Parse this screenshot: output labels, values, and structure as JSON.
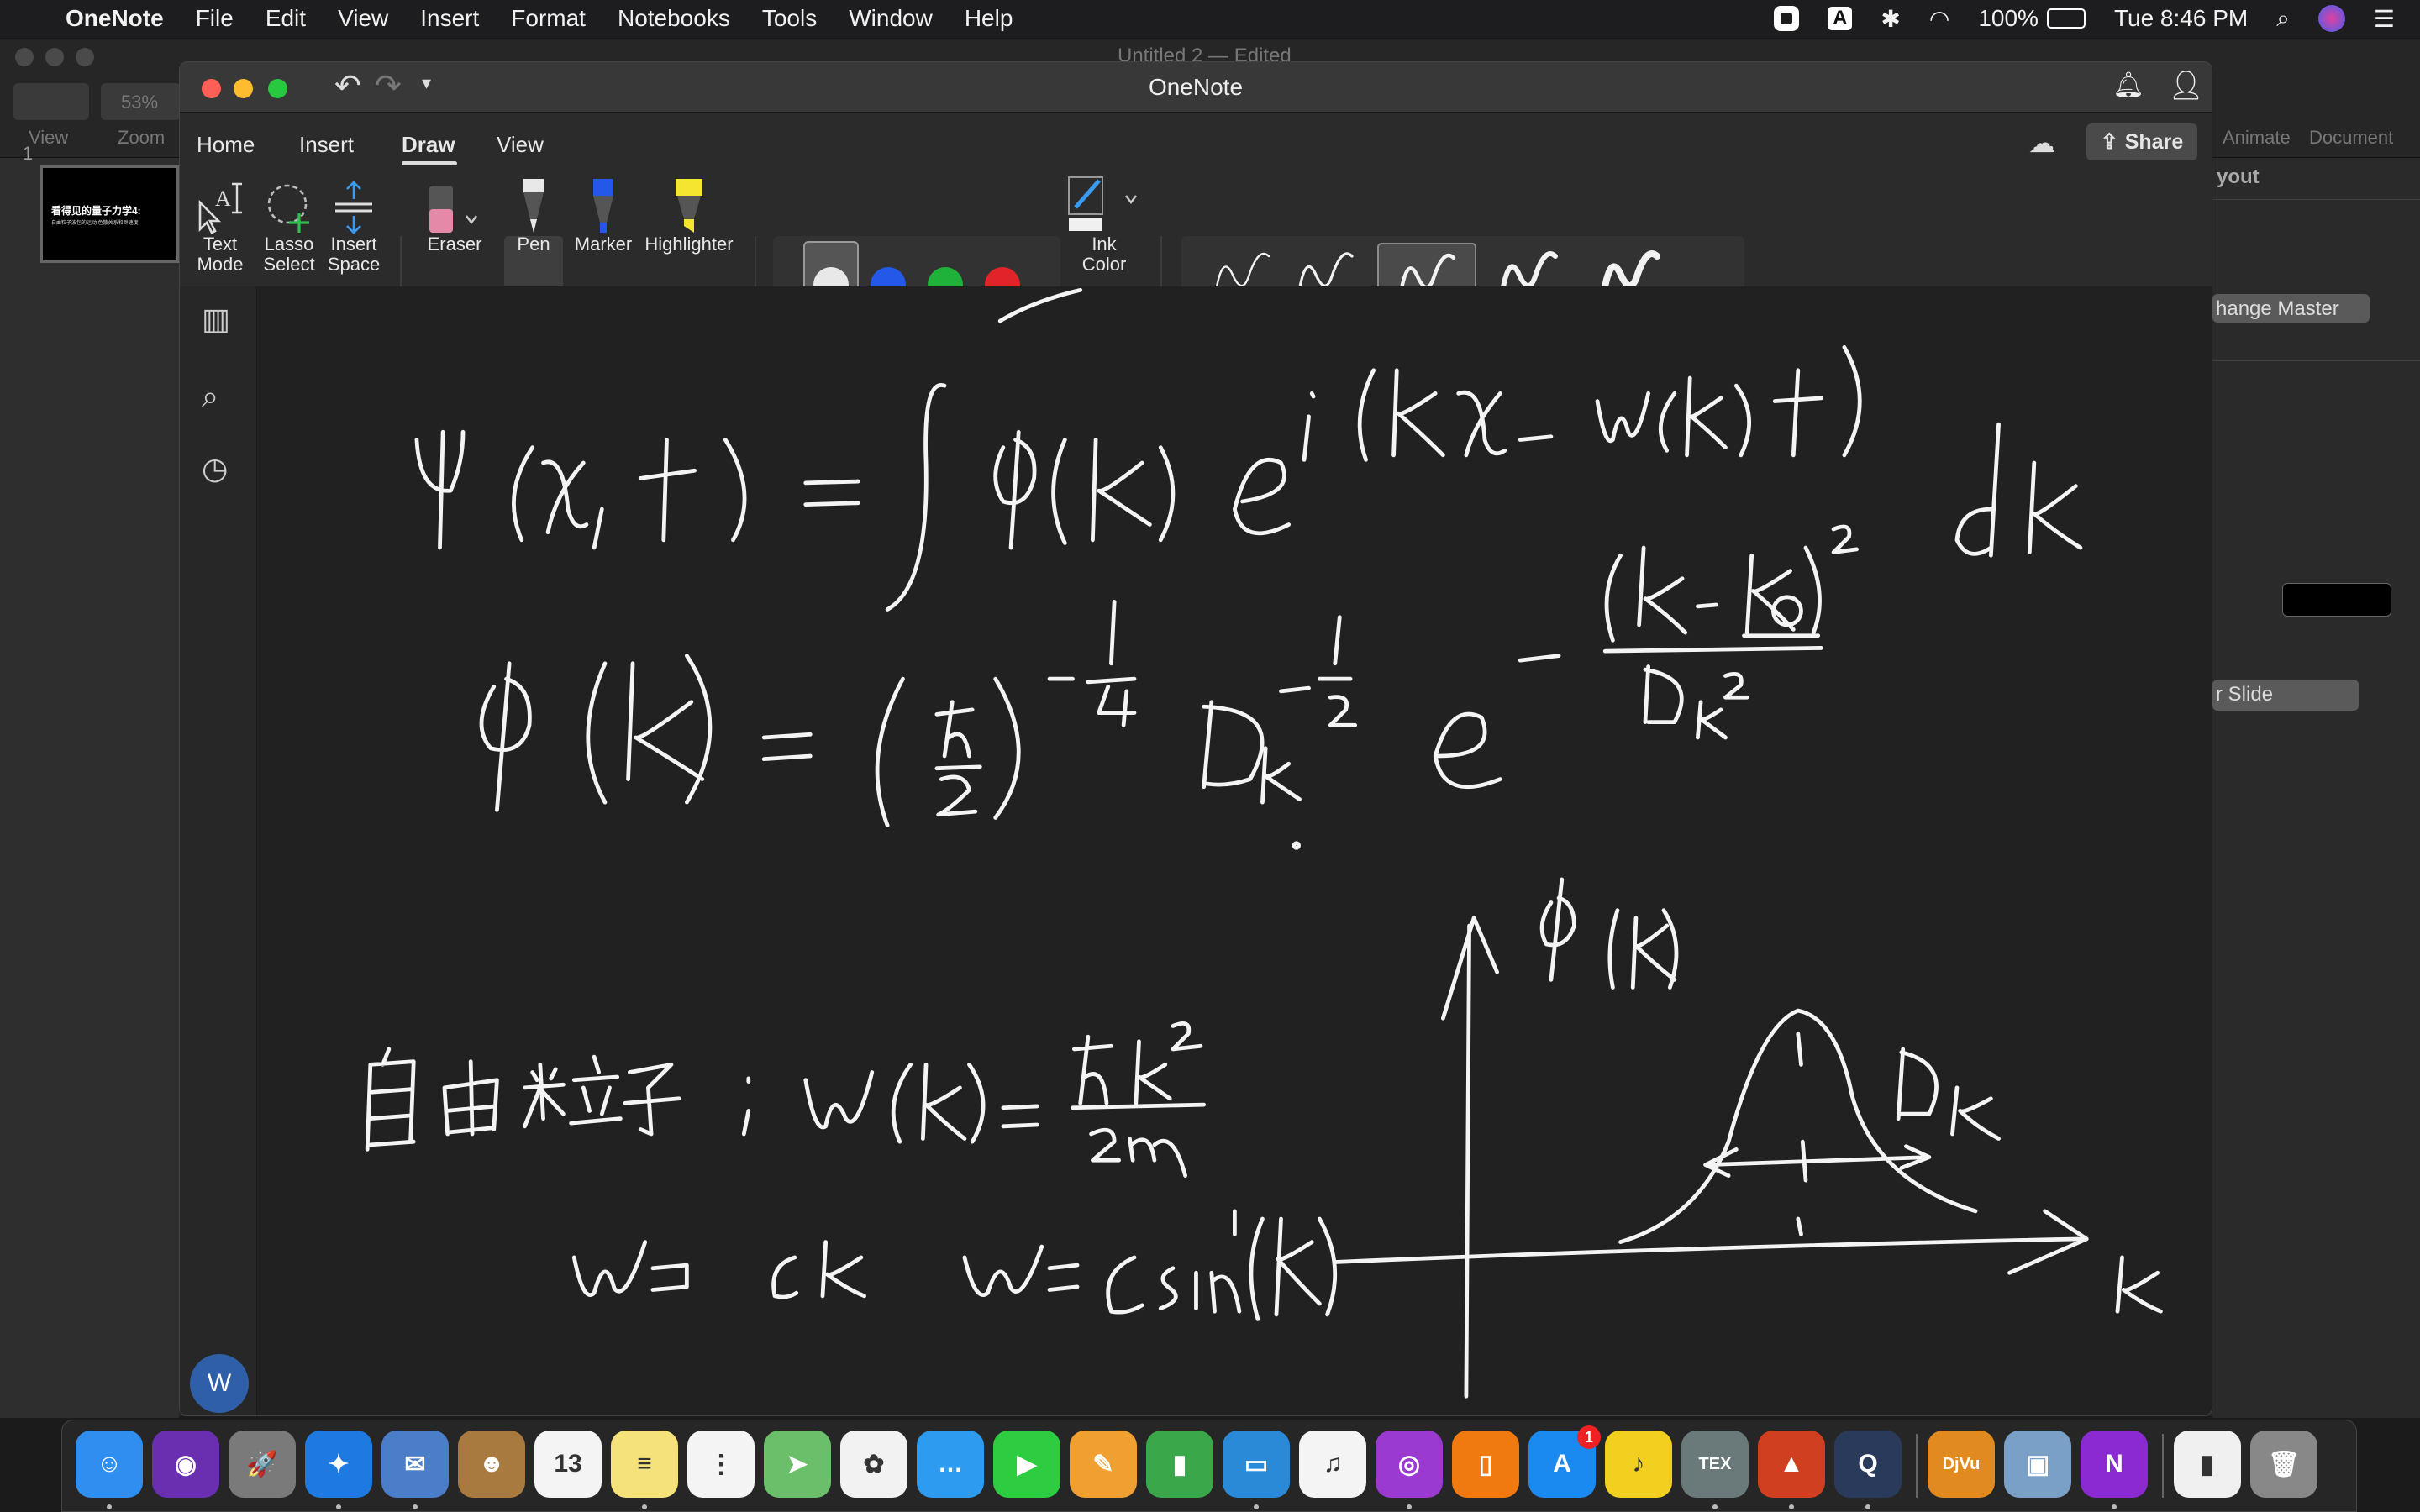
{
  "menubar": {
    "app": "OneNote",
    "items": [
      "File",
      "Edit",
      "View",
      "Insert",
      "Format",
      "Notebooks",
      "Tools",
      "Window",
      "Help"
    ],
    "battery": "100%",
    "clock": "Tue 8:46 PM",
    "icons": [
      "record-icon",
      "input-source-icon",
      "bluetooth-icon",
      "wifi-icon",
      "battery-icon",
      "spotlight-icon",
      "siri-icon",
      "control-center-icon"
    ],
    "input_source": "A"
  },
  "background_app": {
    "title": "Untitled 2 — Edited",
    "zoom": "53%",
    "toolbar_labels": [
      "View",
      "Zoom"
    ],
    "right_labels": [
      "Animate",
      "Document"
    ],
    "panel_header": "yout",
    "change_master": "hange Master",
    "slide_button": "r Slide",
    "slide_number": "1",
    "slide_title": "看得见的量子力学4:",
    "slide_subtitle": "自由粒子波包的运动 色散关系和群速度"
  },
  "window": {
    "title": "OneNote",
    "traffic_colors": [
      "#ff5f57",
      "#febc2e",
      "#28c840"
    ]
  },
  "ribbon": {
    "tabs": [
      {
        "label": "Home"
      },
      {
        "label": "Insert"
      },
      {
        "label": "Draw",
        "selected": true
      },
      {
        "label": "View"
      }
    ],
    "share": "Share",
    "tools": [
      {
        "l1": "Text",
        "l2": "Mode"
      },
      {
        "l1": "Lasso",
        "l2": "Select"
      },
      {
        "l1": "Insert",
        "l2": "Space"
      },
      {
        "l1": "Eraser"
      },
      {
        "l1": "Pen"
      },
      {
        "l1": "Marker"
      },
      {
        "l1": "Highlighter"
      }
    ],
    "pen_colors": [
      "#e8e8e8",
      "#2458e8",
      "#1fb13a",
      "#e0242a"
    ],
    "selected_color": "#e8e8e8",
    "ink_color": {
      "l1": "Ink",
      "l2": "Color"
    },
    "thickness": [
      "0.25 mm",
      "0.35 mm",
      "0.5 mm",
      "0.7 mm",
      "1 mm"
    ],
    "selected_thickness": "0.5 mm"
  },
  "sidebar": {
    "icons": [
      "notebooks-icon",
      "search-icon",
      "recent-icon"
    ],
    "avatar": "W"
  },
  "dock": {
    "apps": [
      {
        "name": "finder",
        "color": "#2f8ef0",
        "g": "☺"
      },
      {
        "name": "siri",
        "color": "#6a2fb0",
        "g": "◉"
      },
      {
        "name": "launchpad",
        "color": "#7a7a7a",
        "g": "🚀"
      },
      {
        "name": "safari",
        "color": "#1e7ae0",
        "g": "✦"
      },
      {
        "name": "mail",
        "color": "#4a7ec8",
        "g": "✉"
      },
      {
        "name": "contacts",
        "color": "#a87a40",
        "g": "☻"
      },
      {
        "name": "calendar",
        "color": "#f4f4f4",
        "g": "13"
      },
      {
        "name": "notes",
        "color": "#f5e27a",
        "g": "≡"
      },
      {
        "name": "reminders",
        "color": "#f4f4f4",
        "g": "⋮"
      },
      {
        "name": "maps",
        "color": "#6cbf6a",
        "g": "➤"
      },
      {
        "name": "photos",
        "color": "#f2f2f2",
        "g": "✿"
      },
      {
        "name": "messages",
        "color": "#2d9cf0",
        "g": "…"
      },
      {
        "name": "facetime",
        "color": "#2ecc40",
        "g": "▶"
      },
      {
        "name": "pages",
        "color": "#f0a030",
        "g": "✎"
      },
      {
        "name": "numbers",
        "color": "#3aa84a",
        "g": "▮"
      },
      {
        "name": "keynote",
        "color": "#2a8ad8",
        "g": "▭"
      },
      {
        "name": "music",
        "color": "#f4f4f4",
        "g": "♫"
      },
      {
        "name": "podcasts",
        "color": "#9a3ad0",
        "g": "◎"
      },
      {
        "name": "books",
        "color": "#f07a10",
        "g": "▯"
      },
      {
        "name": "app-store",
        "color": "#1a8af0",
        "g": "A",
        "badge": "1"
      },
      {
        "name": "music-player",
        "color": "#f2d020",
        "g": "♪"
      },
      {
        "name": "tex",
        "color": "#6a7a7a",
        "g": "TEX"
      },
      {
        "name": "matlab",
        "color": "#d04020",
        "g": "▲"
      },
      {
        "name": "quicktime",
        "color": "#2a3a5a",
        "g": "Q"
      },
      {
        "name": "djvu",
        "color": "#e08a20",
        "g": "DjVu"
      },
      {
        "name": "preview",
        "color": "#7aa0c8",
        "g": "▣"
      },
      {
        "name": "onenote",
        "color": "#8a2ad0",
        "g": "N"
      },
      {
        "name": "rar-archive",
        "color": "#f0f0f0",
        "g": "▮"
      },
      {
        "name": "trash",
        "color": "#888",
        "g": "🗑"
      }
    ]
  }
}
